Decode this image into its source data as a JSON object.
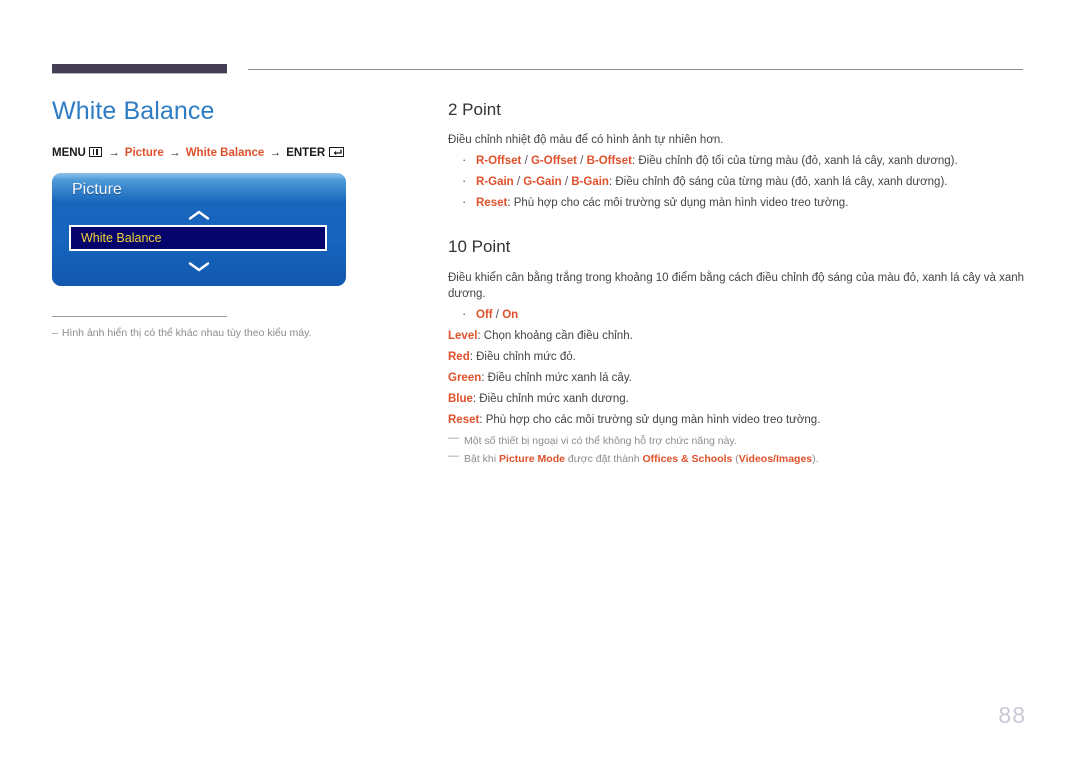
{
  "header": {
    "bar_color": "#453f55",
    "line_color": "#8e8e8e"
  },
  "left": {
    "page_title": "White Balance",
    "menu_path": {
      "menu_label": "MENU",
      "menu_icon": "menu-grid-icon",
      "arrow": "→",
      "step1": "Picture",
      "step2": "White Balance",
      "enter_label": "ENTER",
      "enter_icon": "enter-key-icon"
    },
    "osd": {
      "title": "Picture",
      "up_icon": "chevron-up-icon",
      "down_icon": "chevron-down-icon",
      "selected_row": "White Balance",
      "highlight_bg": "#04036b",
      "highlight_text_color": "#f5d33a"
    },
    "footnote": {
      "dash": "–",
      "text": "Hình ảnh hiển thị có thể khác nhau tùy theo kiểu máy."
    }
  },
  "right": {
    "section_2point": {
      "heading": "2 Point",
      "intro": "Điều chỉnh nhiệt độ màu để có hình ảnh tự nhiên hơn.",
      "bullets": [
        {
          "terms": [
            "R-Offset",
            "G-Offset",
            "B-Offset"
          ],
          "desc": ": Điều chỉnh độ tối của từng màu (đỏ, xanh lá cây, xanh dương)."
        },
        {
          "terms": [
            "R-Gain",
            "G-Gain",
            "B-Gain"
          ],
          "desc": ": Điều chỉnh độ sáng của từng màu (đỏ, xanh lá cây, xanh dương)."
        },
        {
          "terms": [
            "Reset"
          ],
          "desc": ": Phù hợp cho các môi trường sử dụng màn hình video treo tường."
        }
      ]
    },
    "section_10point": {
      "heading": "10 Point",
      "intro": "Điều khiển cân bằng trắng trong khoảng 10 điểm bằng cách điều chỉnh độ sáng của màu đỏ, xanh lá cây và xanh dương.",
      "toggle_bullet": {
        "terms": [
          "Off",
          "On"
        ]
      },
      "items": [
        {
          "term": "Level",
          "desc": ": Chọn khoảng cần điều chỉnh."
        },
        {
          "term": "Red",
          "desc": ": Điều chỉnh mức đỏ."
        },
        {
          "term": "Green",
          "desc": ": Điều chỉnh mức xanh lá cây."
        },
        {
          "term": "Blue",
          "desc": ": Điều chỉnh mức xanh dương."
        },
        {
          "term": "Reset",
          "desc": ": Phù hợp cho các môi trường sử dụng màn hình video treo tường."
        }
      ],
      "notes": [
        {
          "marker": "—",
          "plain": "Một số thiết bị ngoại vi có thể không hỗ trợ chức năng này."
        },
        {
          "marker": "—",
          "p1": "Bật khi ",
          "a1": "Picture Mode",
          "p2": " được đặt thành ",
          "a2": "Offices & Schools",
          "p3": " (",
          "a3": "Videos/Images",
          "p4": ")."
        }
      ]
    }
  },
  "page_number": "88",
  "accent_color": "#e0512b",
  "title_color": "#2d7cc4"
}
